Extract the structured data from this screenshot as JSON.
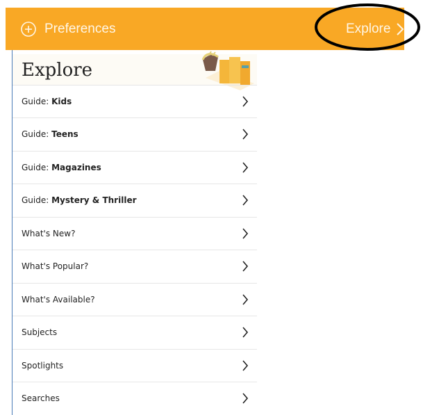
{
  "topbar": {
    "preferences_label": "Preferences",
    "explore_label": "Explore",
    "bg_color": "#f9a825"
  },
  "panel": {
    "title": "Explore",
    "items": [
      {
        "prefix": "Guide: ",
        "bold": "Kids"
      },
      {
        "prefix": "Guide: ",
        "bold": "Teens"
      },
      {
        "prefix": "Guide: ",
        "bold": "Magazines"
      },
      {
        "prefix": "Guide: ",
        "bold": "Mystery & Thriller"
      },
      {
        "prefix": "What's New?",
        "bold": ""
      },
      {
        "prefix": "What's Popular?",
        "bold": ""
      },
      {
        "prefix": "What's Available?",
        "bold": ""
      },
      {
        "prefix": "Subjects",
        "bold": ""
      },
      {
        "prefix": "Spotlights",
        "bold": ""
      },
      {
        "prefix": "Searches",
        "bold": ""
      }
    ]
  },
  "icons": {
    "preferences": "plus-circle-icon",
    "explore": "chevron-right-icon",
    "header_art": "books-icon",
    "row": "chevron-right-icon"
  }
}
